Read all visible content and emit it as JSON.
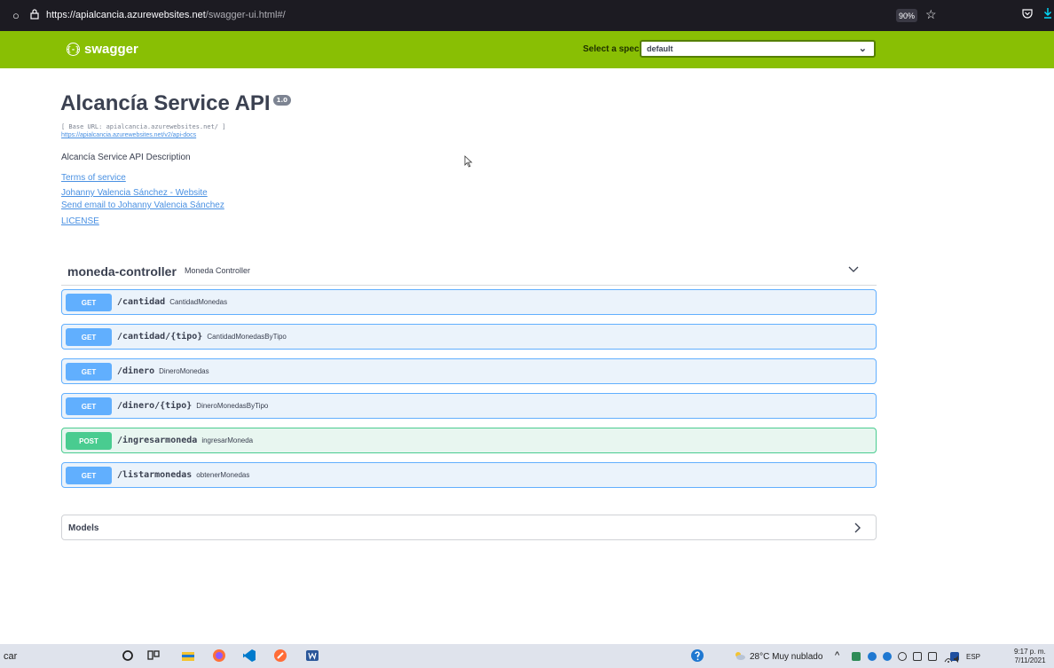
{
  "browser": {
    "url_host": "https://apialcancia.azurewebsites.net",
    "url_path": "/swagger-ui.html#/",
    "zoom": "90%"
  },
  "swagger": {
    "logo_text": "swagger",
    "logo_mark": "{-}",
    "spec_label": "Select a spec",
    "spec_value": "default"
  },
  "info": {
    "title": "Alcancía Service API",
    "version": "1.0",
    "base_url": "[ Base URL: apialcancia.azurewebsites.net/ ]",
    "docs_link": "https://apialcancia.azurewebsites.net/v2/api-docs",
    "description": "Alcancía Service API Description",
    "links": [
      "Terms of service",
      "Johanny Valencia Sánchez - Website",
      "Send email to Johanny Valencia Sánchez"
    ],
    "license": "LICENSE"
  },
  "tag": {
    "name": "moneda-controller",
    "description": "Moneda Controller"
  },
  "operations": [
    {
      "method": "GET",
      "path": "/cantidad",
      "summary": "CantidadMonedas"
    },
    {
      "method": "GET",
      "path": "/cantidad/{tipo}",
      "summary": "CantidadMonedasByTipo"
    },
    {
      "method": "GET",
      "path": "/dinero",
      "summary": "DineroMonedas"
    },
    {
      "method": "GET",
      "path": "/dinero/{tipo}",
      "summary": "DineroMonedasByTipo"
    },
    {
      "method": "POST",
      "path": "/ingresarmoneda",
      "summary": "ingresarMoneda"
    },
    {
      "method": "GET",
      "path": "/listarmonedas",
      "summary": "obtenerMonedas"
    }
  ],
  "models": {
    "title": "Models"
  },
  "taskbar": {
    "search_fragment": "car",
    "weather": "28°C  Muy nublado",
    "lang": "ESP",
    "time": "9:17 p. m.",
    "date": "7/11/2021"
  },
  "colors": {
    "topbar": "#89bf04",
    "get": "#61affe",
    "post": "#49cc90",
    "link": "#4990e2"
  }
}
